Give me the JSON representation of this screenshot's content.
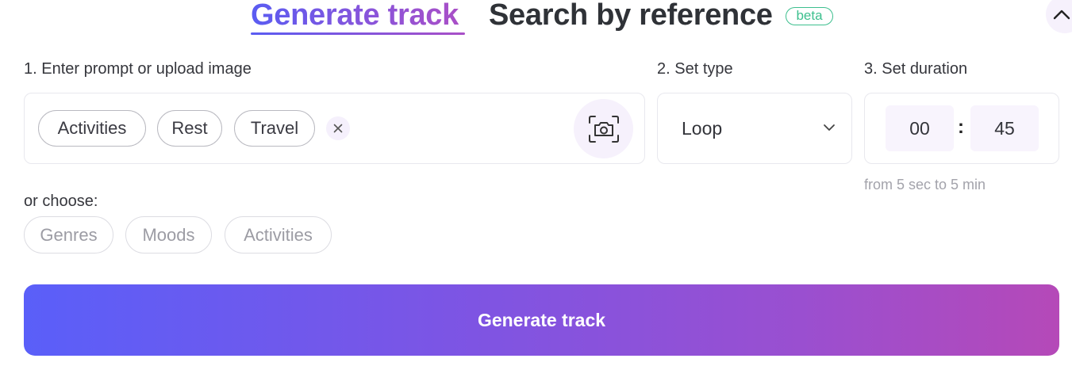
{
  "tabs": {
    "generate": "Generate track",
    "search": "Search by reference",
    "beta": "beta"
  },
  "labels": {
    "prompt": "1. Enter prompt or upload image",
    "type": "2. Set type",
    "duration": "3. Set duration",
    "choose": "or choose:"
  },
  "prompt_tags": [
    "Activities",
    "Rest",
    "Travel"
  ],
  "type": {
    "value": "Loop"
  },
  "duration": {
    "minutes": "00",
    "seconds": "45",
    "separator": ":",
    "hint": "from 5 sec to 5 min"
  },
  "choose_chips": [
    "Genres",
    "Moods",
    "Activities"
  ],
  "generate_button": "Generate track",
  "colors": {
    "accent_start": "#5a5ff9",
    "accent_end": "#b549b8",
    "beta_green": "#3dbf8e"
  },
  "icons": {
    "collapse": "chevron-up-icon",
    "clear": "close-icon",
    "upload": "camera-icon",
    "dropdown": "chevron-down-icon"
  }
}
